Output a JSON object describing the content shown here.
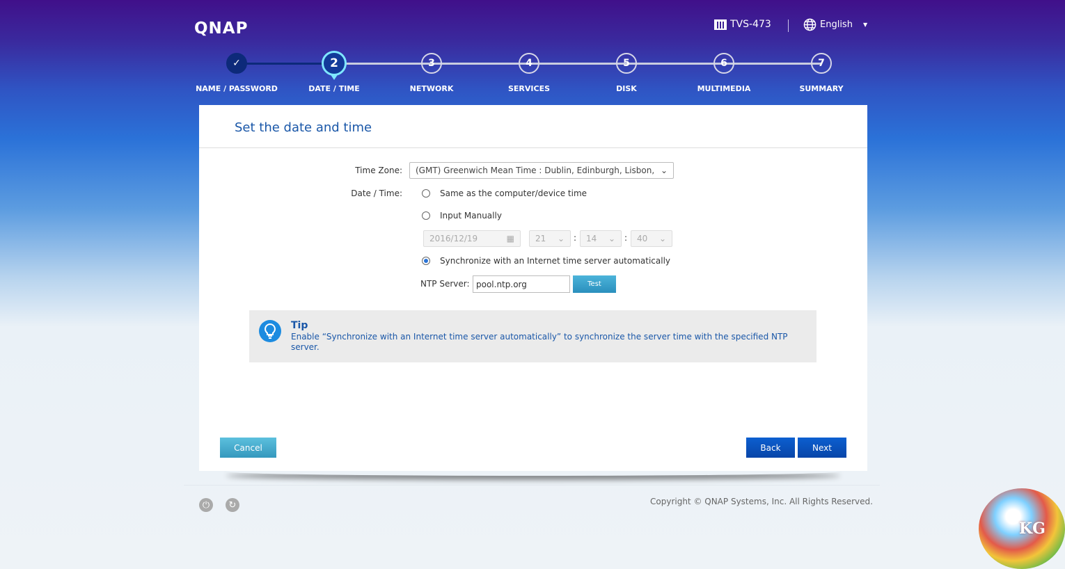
{
  "header": {
    "brand": "QNAP",
    "model": "TVS-473",
    "language": "English"
  },
  "steps": [
    {
      "number": "✓",
      "label": "NAME / PASSWORD",
      "state": "done"
    },
    {
      "number": "2",
      "label": "DATE / TIME",
      "state": "current"
    },
    {
      "number": "3",
      "label": "NETWORK",
      "state": "pending"
    },
    {
      "number": "4",
      "label": "SERVICES",
      "state": "pending"
    },
    {
      "number": "5",
      "label": "DISK",
      "state": "pending"
    },
    {
      "number": "6",
      "label": "MULTIMEDIA",
      "state": "pending"
    },
    {
      "number": "7",
      "label": "SUMMARY",
      "state": "pending"
    }
  ],
  "panel": {
    "title": "Set the date and time",
    "timezone_label": "Time Zone:",
    "timezone_value": "(GMT) Greenwich Mean Time : Dublin, Edinburgh, Lisbon, L",
    "datetime_label": "Date / Time:",
    "options": [
      "Same as the computer/device time",
      "Input Manually",
      "Synchronize with an Internet time server automatically"
    ],
    "selected_option": 2,
    "date": "2016/12/19",
    "hour": "21",
    "minute": "14",
    "second": "40",
    "ntp_label": "NTP Server:",
    "ntp_value": "pool.ntp.org",
    "test_label": "Test",
    "tip_title": "Tip",
    "tip_text": "Enable “Synchronize with an Internet time server automatically” to synchronize the server time with the specified NTP server.",
    "cancel": "Cancel",
    "back": "Back",
    "next": "Next"
  },
  "footer": {
    "copyright": "Copyright © QNAP Systems, Inc. All Rights Reserved."
  },
  "watermark": "KG",
  "colors": {
    "accent": "#1a57a8",
    "primary_button": "#0a55c4",
    "secondary_button": "#3aa4c8"
  }
}
